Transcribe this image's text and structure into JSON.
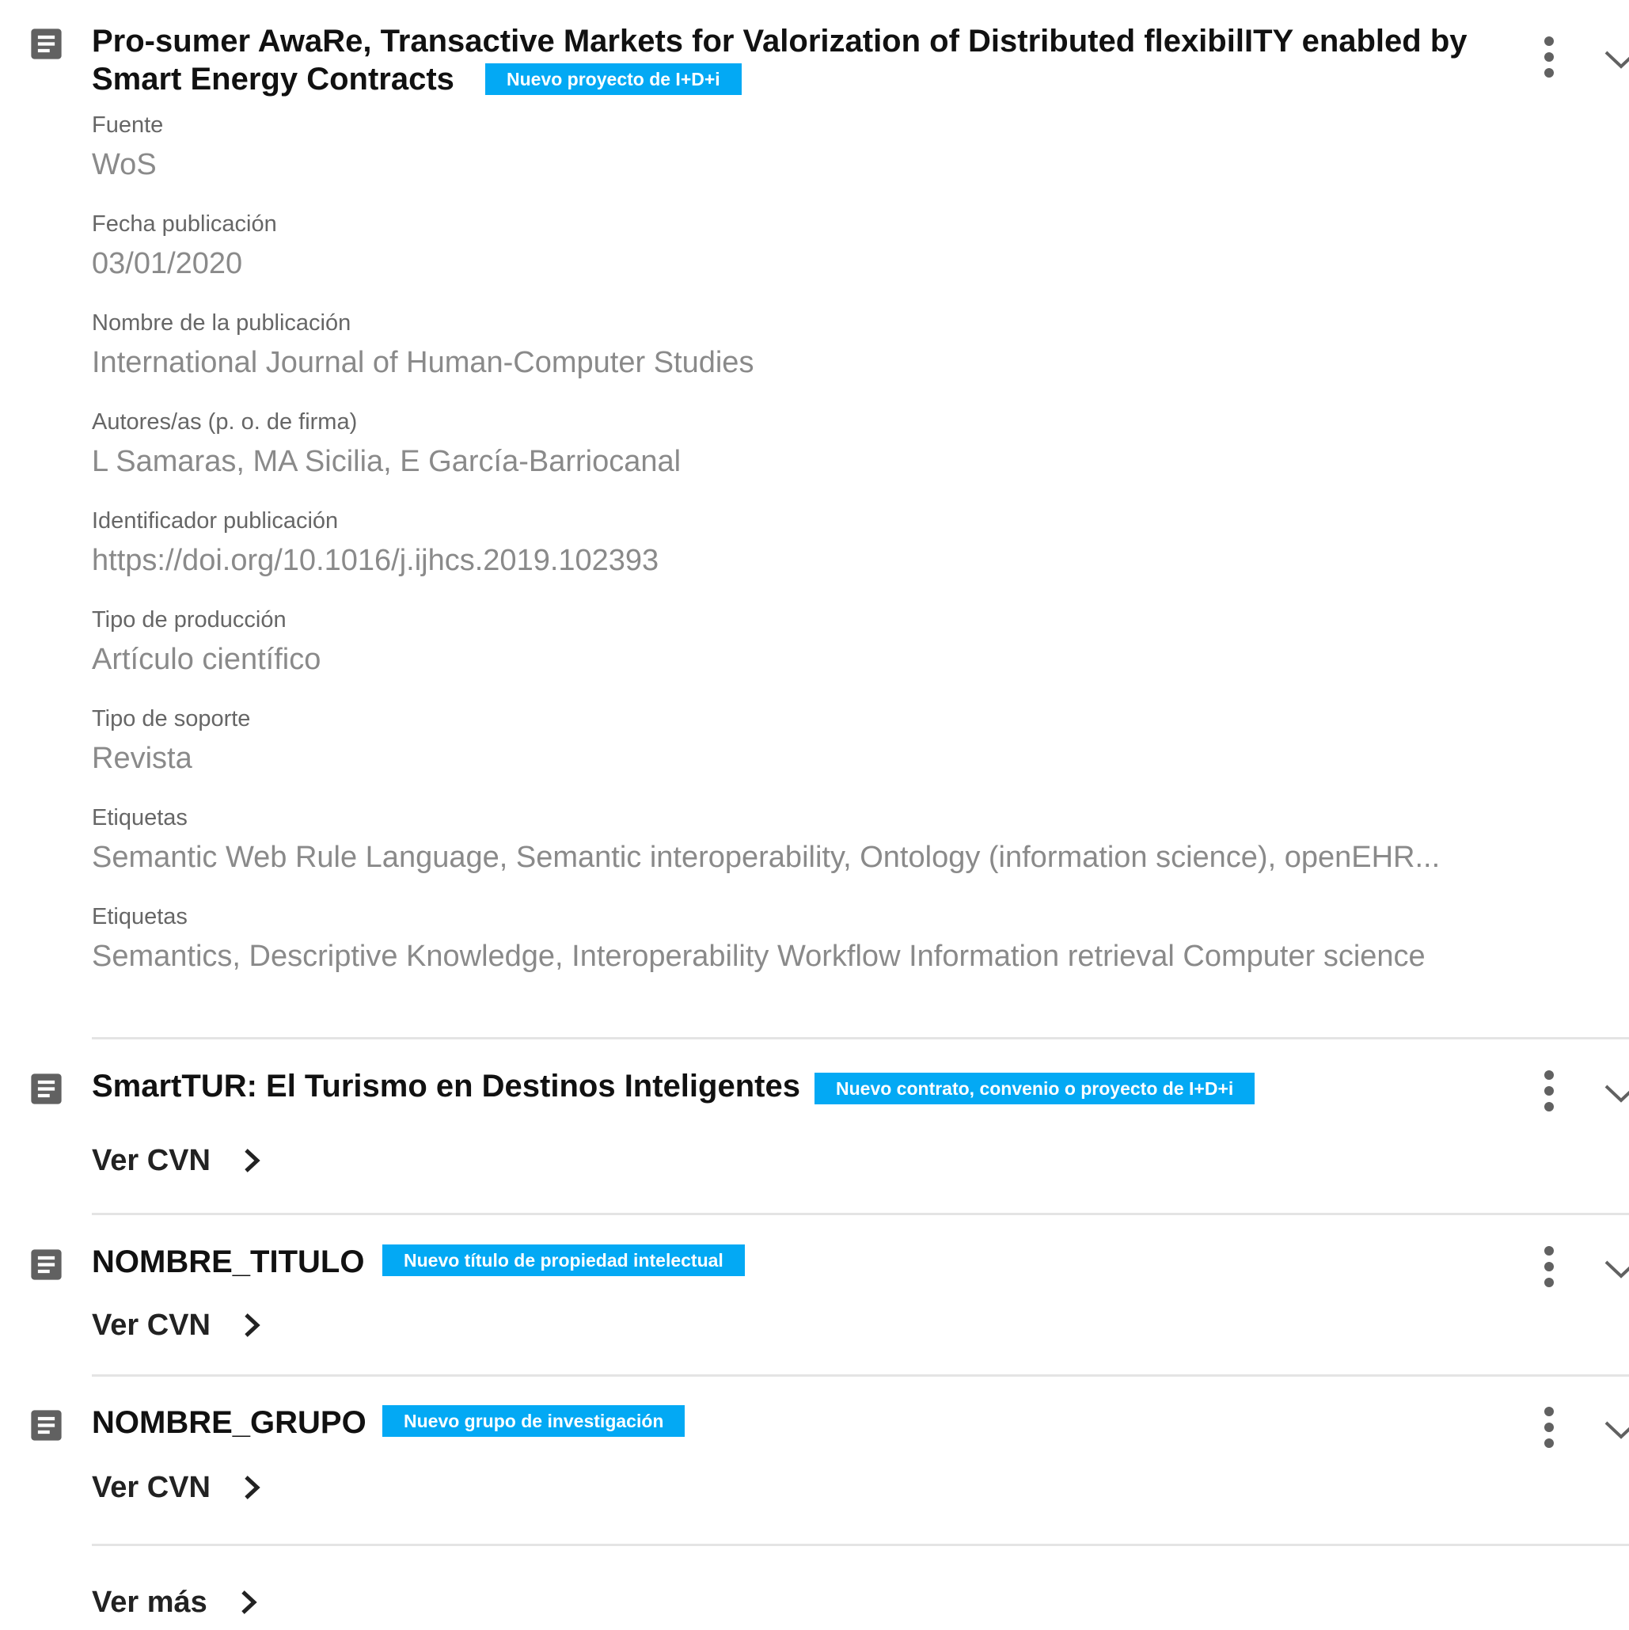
{
  "items": [
    {
      "title_line1": "Pro-sumer AwaRe, Transactive Markets for Valorization of Distributed flexibilITY enabled by",
      "title_line2": "Smart Energy Contracts",
      "badge": "Nuevo proyecto de I+D+i",
      "fields": [
        {
          "label": "Fuente",
          "value": "WoS"
        },
        {
          "label": "Fecha publicación",
          "value": "03/01/2020"
        },
        {
          "label": "Nombre de la publicación",
          "value": "International Journal of Human-Computer Studies"
        },
        {
          "label": "Autores/as (p. o. de firma)",
          "value": "L Samaras, MA Sicilia, E García-Barriocanal"
        },
        {
          "label": "Identificador publicación",
          "value": "https://doi.org/10.1016/j.ijhcs.2019.102393"
        },
        {
          "label": "Tipo de producción",
          "value": "Artículo científico"
        },
        {
          "label": "Tipo de soporte",
          "value": "Revista"
        },
        {
          "label": "Etiquetas",
          "value": "Semantic Web Rule Language,  Semantic interoperability, Ontology (information science), openEHR..."
        },
        {
          "label": "Etiquetas",
          "value": "Semantics,  Descriptive Knowledge, Interoperability Workflow Information retrieval Computer science"
        }
      ]
    },
    {
      "title": "SmartTUR: El Turismo en Destinos Inteligentes",
      "badge": "Nuevo contrato, convenio o proyecto de I+D+i",
      "link": "Ver CVN"
    },
    {
      "title": "NOMBRE_TITULO",
      "badge": "Nuevo título de propiedad intelectual",
      "link": "Ver CVN"
    },
    {
      "title": "NOMBRE_GRUPO",
      "badge": "Nuevo grupo de investigación",
      "link": "Ver CVN"
    }
  ],
  "footer": {
    "more_label": "Ver más"
  },
  "icons": {
    "item_icon": "document-icon",
    "menu_icon": "more-vert-icon",
    "expand_icon": "chevron-down-icon",
    "link_icon": "chevron-right-icon"
  },
  "colors": {
    "badge_bg": "#03a9f4",
    "badge_text": "#ffffff",
    "icon_grey": "#616161",
    "divider": "#e4e4e4"
  }
}
